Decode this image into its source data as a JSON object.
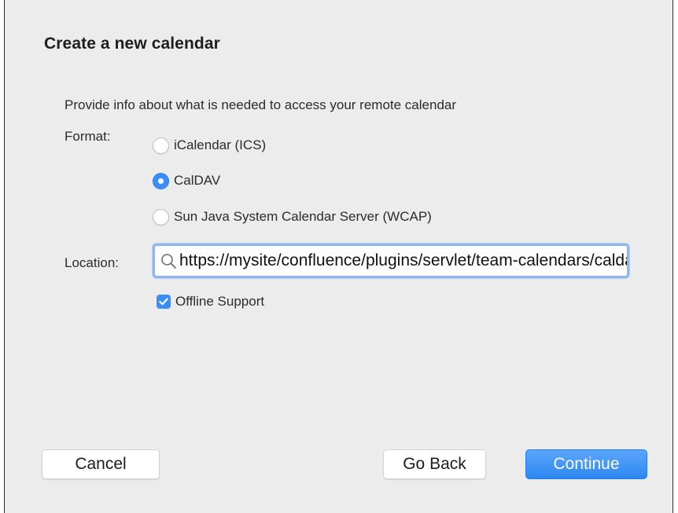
{
  "dialog": {
    "title": "Create a new calendar",
    "info": "Provide info about what is needed to access your remote calendar"
  },
  "format": {
    "label": "Format:",
    "options": [
      {
        "label": "iCalendar (ICS)",
        "selected": false
      },
      {
        "label": "CalDAV",
        "selected": true
      },
      {
        "label": "Sun Java System Calendar Server (WCAP)",
        "selected": false
      }
    ]
  },
  "location": {
    "label": "Location:",
    "value": "https://mysite/confluence/plugins/servlet/team-calendars/caldav",
    "icon": "search-icon"
  },
  "offline": {
    "label": "Offline Support",
    "checked": true
  },
  "buttons": {
    "cancel": "Cancel",
    "back": "Go Back",
    "continue": "Continue"
  },
  "colors": {
    "accent": "#3a8ef5",
    "background": "#ececec"
  }
}
